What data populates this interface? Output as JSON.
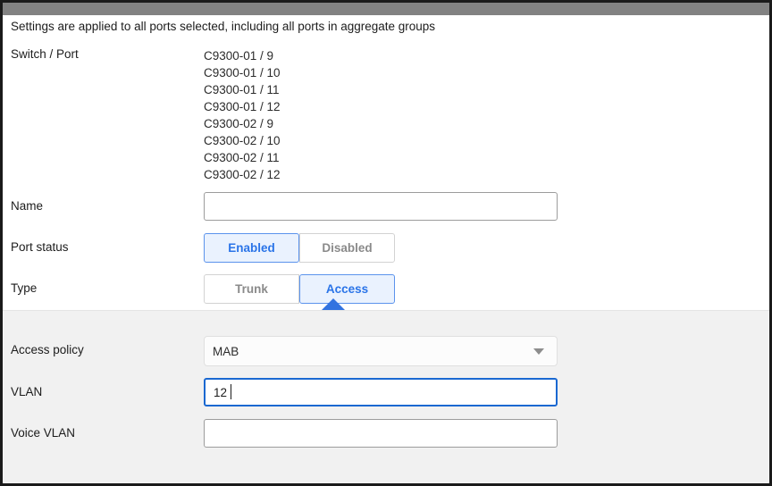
{
  "notice": "Settings are applied to all ports selected, including all ports in aggregate groups",
  "form": {
    "switch_port": {
      "label": "Switch / Port",
      "ports": [
        "C9300-01 / 9",
        "C9300-01 / 10",
        "C9300-01 / 11",
        "C9300-01 / 12",
        "C9300-02 / 9",
        "C9300-02 / 10",
        "C9300-02 / 11",
        "C9300-02 / 12"
      ]
    },
    "name": {
      "label": "Name",
      "value": "",
      "placeholder": ""
    },
    "port_status": {
      "label": "Port status",
      "options": [
        "Enabled",
        "Disabled"
      ],
      "selected": "Enabled"
    },
    "type": {
      "label": "Type",
      "options": [
        "Trunk",
        "Access"
      ],
      "selected": "Access"
    },
    "access_policy": {
      "label": "Access policy",
      "value": "MAB",
      "icon": "chevron-down-icon"
    },
    "vlan": {
      "label": "VLAN",
      "value": "12",
      "placeholder": "",
      "focused": true
    },
    "voice_vlan": {
      "label": "Voice VLAN",
      "value": "",
      "placeholder": ""
    }
  },
  "colors": {
    "accent_blue": "#2a74e8",
    "accent_blue_fill": "#eaf2fe",
    "accent_blue_border": "#5b93ec",
    "pointer_blue": "#3273e0",
    "focus_border": "#1a68d1",
    "header_gray": "#828282",
    "panel_gray": "#f1f1f1",
    "text_dark": "#1c1c1c",
    "text_muted": "#8a8a8a"
  }
}
